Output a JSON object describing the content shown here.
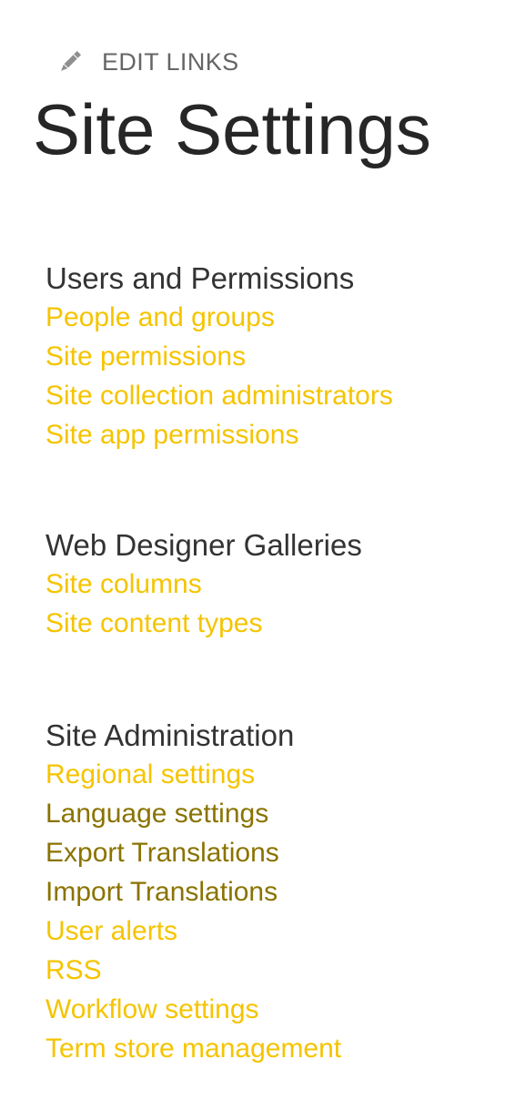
{
  "edit_links": {
    "label": "EDIT LINKS",
    "icon": "pencil-icon"
  },
  "page_title": "Site Settings",
  "colors": {
    "link": "#f5c400",
    "link_visited": "#8a7300",
    "heading": "#333333",
    "title": "#262626",
    "edit_label": "#666666"
  },
  "sections": [
    {
      "heading": "Users and Permissions",
      "links": [
        {
          "label": "People and groups",
          "visited": false
        },
        {
          "label": "Site permissions",
          "visited": false
        },
        {
          "label": "Site collection administrators",
          "visited": false
        },
        {
          "label": "Site app permissions",
          "visited": false
        }
      ]
    },
    {
      "heading": "Web Designer Galleries",
      "links": [
        {
          "label": "Site columns",
          "visited": false
        },
        {
          "label": "Site content types",
          "visited": false
        }
      ]
    },
    {
      "heading": "Site Administration",
      "links": [
        {
          "label": "Regional settings",
          "visited": false
        },
        {
          "label": "Language settings",
          "visited": true
        },
        {
          "label": "Export Translations",
          "visited": true
        },
        {
          "label": "Import Translations",
          "visited": true
        },
        {
          "label": "User alerts",
          "visited": false
        },
        {
          "label": "RSS",
          "visited": false
        },
        {
          "label": "Workflow settings",
          "visited": false
        },
        {
          "label": "Term store management",
          "visited": false
        }
      ]
    }
  ]
}
